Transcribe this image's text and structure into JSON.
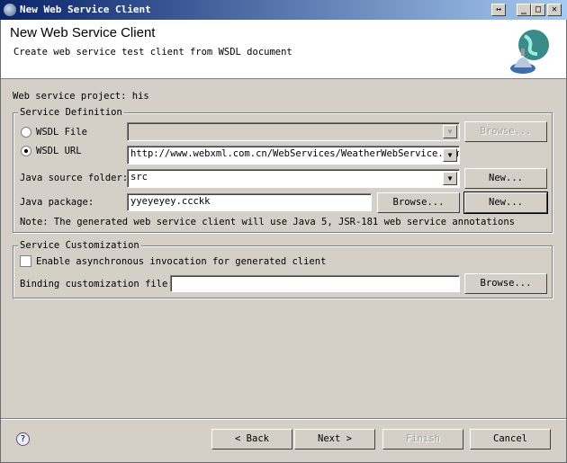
{
  "window": {
    "title": "New Web Service Client"
  },
  "header": {
    "title": "New Web Service Client",
    "subtitle": "Create web service test client from WSDL document",
    "icon": "web-service-globe-icon"
  },
  "project": {
    "label": "Web service project: his"
  },
  "service_definition": {
    "group_label": "Service Definition",
    "wsdl_file": {
      "label": "WSDL File",
      "selected": false,
      "value": "",
      "browse_label": "Browse..."
    },
    "wsdl_url": {
      "label": "WSDL URL",
      "selected": true,
      "value": "http://www.webxml.com.cn/WebServices/WeatherWebService.asmx?wsdl"
    },
    "source_folder": {
      "label": "Java source folder:",
      "value": "src",
      "new_label": "New..."
    },
    "package": {
      "label": "Java package:",
      "value": "yyeyeyey.ccckk",
      "browse_label": "Browse...",
      "new_label": "New..."
    },
    "note": "Note: The generated web service client will use Java 5, JSR-181 web service annotations"
  },
  "customization": {
    "group_label": "Service Customization",
    "async": {
      "label": "Enable asynchronous invocation for generated client",
      "checked": false
    },
    "binding": {
      "label": "Binding customization file:",
      "value": "",
      "browse_label": "Browse..."
    }
  },
  "footer": {
    "back": "< Back",
    "next": "Next >",
    "finish": "Finish",
    "cancel": "Cancel"
  }
}
